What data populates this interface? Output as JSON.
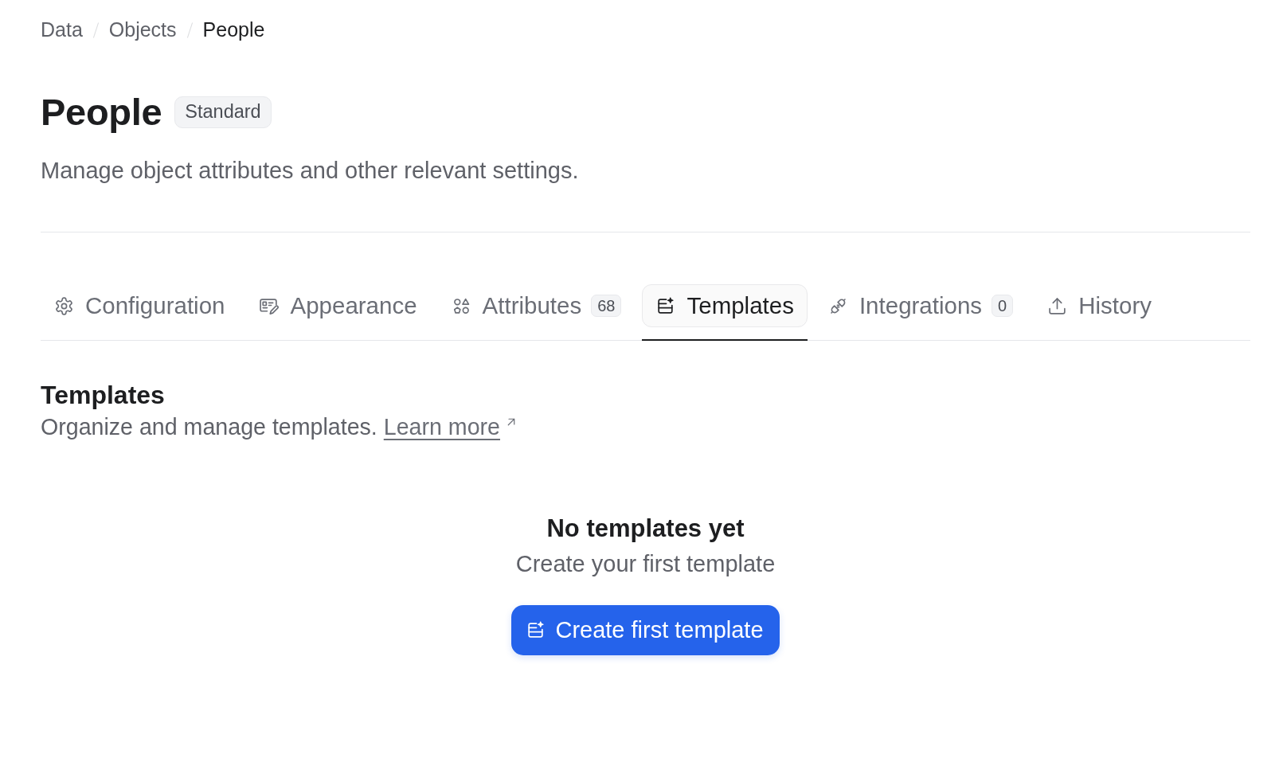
{
  "breadcrumb": [
    {
      "label": "Data",
      "current": false
    },
    {
      "label": "Objects",
      "current": false
    },
    {
      "label": "People",
      "current": true
    }
  ],
  "header": {
    "title": "People",
    "badge": "Standard",
    "description": "Manage object attributes and other relevant settings."
  },
  "tabs": [
    {
      "label": "Configuration",
      "selected": false
    },
    {
      "label": "Appearance",
      "selected": false
    },
    {
      "label": "Attributes",
      "count": "68",
      "selected": false
    },
    {
      "label": "Templates",
      "selected": true
    },
    {
      "label": "Integrations",
      "count": "0",
      "selected": false
    },
    {
      "label": "History",
      "selected": false
    }
  ],
  "section": {
    "title": "Templates",
    "description": "Organize and manage templates.",
    "link": "Learn more"
  },
  "empty_state": {
    "title": "No templates yet",
    "subtitle": "Create your first template",
    "button": "Create first template"
  }
}
